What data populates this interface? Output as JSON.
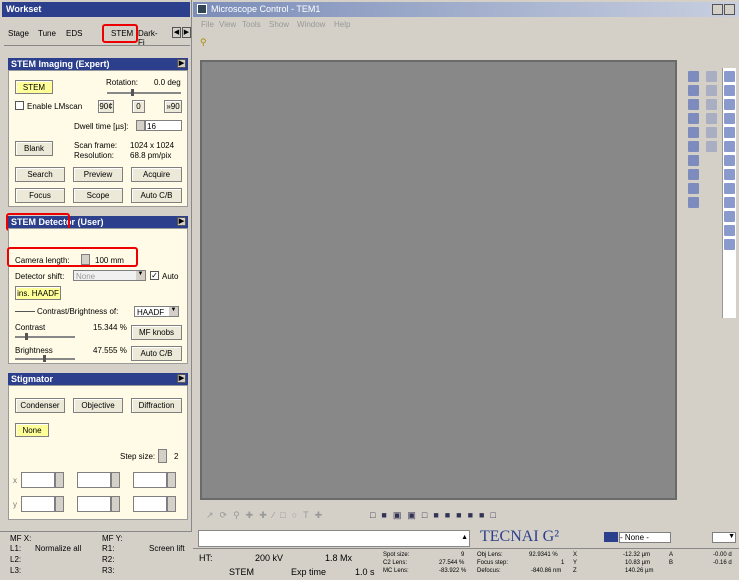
{
  "workset": {
    "title": "Workset",
    "tabs": [
      "Stage",
      "Tune",
      "EDS",
      "STEM",
      "Dark-Fi"
    ],
    "active_tab": "STEM"
  },
  "imaging": {
    "title": "STEM Imaging (Expert)",
    "stem_label": "STEM",
    "rotation_label": "Rotation:",
    "rotation_value": "0.0 deg",
    "lmscan_label": "Enable LMscan",
    "rot_btns": [
      "90¢",
      "0",
      "»90"
    ],
    "dwell_label": "Dwell time [µs]:",
    "dwell_value": "16",
    "scan_frame_label": "Scan frame:",
    "scan_frame_value": "1024 x 1024",
    "resolution_label": "Resolution:",
    "resolution_value": "68.8 pm/pix",
    "blank": "Blank",
    "search": "Search",
    "preview": "Preview",
    "acquire": "Acquire",
    "focus": "Focus",
    "scope": "Scope",
    "autocb": "Auto C/B"
  },
  "detector": {
    "title": "STEM Detector (User)",
    "camera_length_label": "Camera length:",
    "camera_length_value": "100 mm",
    "shift_label": "Detector shift:",
    "shift_value": "None",
    "auto_label": "Auto",
    "ins_haadf": "ins. HAADF",
    "cb_of_label": "Contrast/Brightness of:",
    "cb_of_value": "HAADF",
    "contrast_label": "Contrast",
    "contrast_value": "15.344 %",
    "mf_knobs": "MF knobs",
    "brightness_label": "Brightness",
    "brightness_value": "47.555 %",
    "autocb": "Auto C/B"
  },
  "stigmator": {
    "title": "Stigmator",
    "buttons": [
      "Condenser",
      "Objective",
      "Diffraction"
    ],
    "none": "None",
    "step_label": "Step size:",
    "step_value": "2",
    "x_label": "x",
    "y_label": "y"
  },
  "mf": {
    "row0": [
      "MF X:",
      "MF Y:"
    ],
    "l1": "L1:",
    "normalize": "Normalize all",
    "r1": "R1:",
    "screen_lift": "Screen lift",
    "l2": "L2:",
    "r2": "R2:",
    "l3": "L3:",
    "r3": "R3:"
  },
  "main": {
    "title": "Microscope Control - TEM1",
    "menu": [
      "File",
      "View",
      "Tools",
      "Show",
      "Window",
      "Help"
    ]
  },
  "status": {
    "ht_label": "HT:",
    "ht_value": "200 kV",
    "mag": "1.8 Mx",
    "mode": "STEM",
    "exp_label": "Exp time",
    "exp_value": "1.0 s",
    "spot_label": "Spot size:",
    "spot_value": "9",
    "c2_label": "C2 Lens:",
    "c2_value": "27.544 %",
    "mc_label": "MC Lens:",
    "mc_value": "-83.922 %",
    "obj_label": "Obj Lens:",
    "obj_value": "92.9341 %",
    "fstep_label": "Focus step:",
    "fstep_value": "1",
    "defocus_label": "Defocus:",
    "defocus_value": "-840.86 nm",
    "x": "X",
    "y": "Y",
    "z": "Z",
    "xv": "-12.32 µm",
    "yv": "10.83 µm",
    "zv": "140.26 µm",
    "a": "A",
    "b": "B",
    "av": "-0.00 d",
    "bv": "-0.16 d",
    "brand": "TECNAI G²",
    "none_sel": "- None -"
  }
}
